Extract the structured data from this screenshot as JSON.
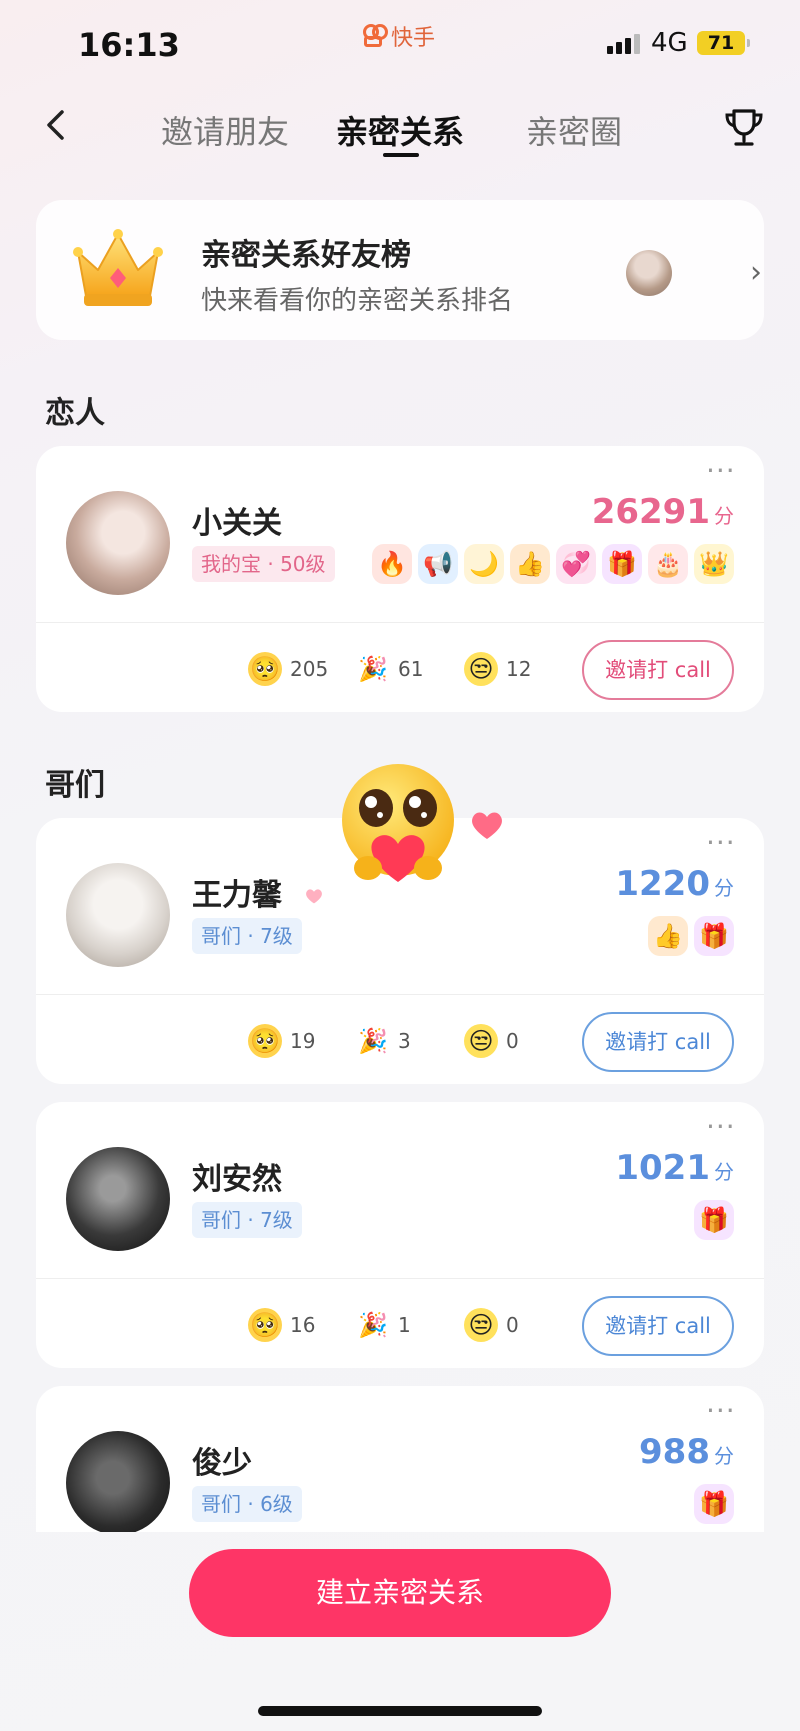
{
  "status_bar": {
    "time": "16:13",
    "carrier": "快手",
    "network": "4G",
    "battery": "71"
  },
  "nav": {
    "tabs": [
      {
        "label": "邀请朋友",
        "active": false
      },
      {
        "label": "亲密关系",
        "active": true
      },
      {
        "label": "亲密圈",
        "active": false
      }
    ],
    "back_icon": "chevron-left-icon",
    "trophy_icon": "trophy-icon"
  },
  "ranking_banner": {
    "title": "亲密关系好友榜",
    "subtitle": "快来看看你的亲密关系排名",
    "chevron": "›"
  },
  "sections": {
    "lovers": {
      "label": "恋人"
    },
    "buddies": {
      "label": "哥们"
    }
  },
  "more_icon": "···",
  "friends": [
    {
      "name": "小关关",
      "tag": "我的宝 · 50级",
      "score": "26291",
      "unit": "分",
      "badges": [
        "🔥",
        "📢",
        "🌙",
        "👍",
        "💞",
        "🎁",
        "🎂",
        "👑"
      ],
      "stats": {
        "hug": "205",
        "party": "61",
        "sour": "12"
      },
      "call_label": "邀请打 call",
      "theme": "pink"
    },
    {
      "name": "王力馨",
      "tag": "哥们 · 7级",
      "score": "1220",
      "unit": "分",
      "badges": [
        "👍",
        "🎁"
      ],
      "stats": {
        "hug": "19",
        "party": "3",
        "sour": "0"
      },
      "call_label": "邀请打 call",
      "theme": "blue"
    },
    {
      "name": "刘安然",
      "tag": "哥们 · 7级",
      "score": "1021",
      "unit": "分",
      "badges": [
        "🎁"
      ],
      "stats": {
        "hug": "16",
        "party": "1",
        "sour": "0"
      },
      "call_label": "邀请打 call",
      "theme": "blue"
    },
    {
      "name": "俊少",
      "tag": "哥们 · 6级",
      "score": "988",
      "unit": "分",
      "badges": [
        "🎁"
      ],
      "theme": "blue"
    }
  ],
  "create_button": {
    "label": "建立亲密关系"
  },
  "colors": {
    "primary": "#fe3566",
    "pink": "#e8668e",
    "blue": "#5b8fdd"
  }
}
